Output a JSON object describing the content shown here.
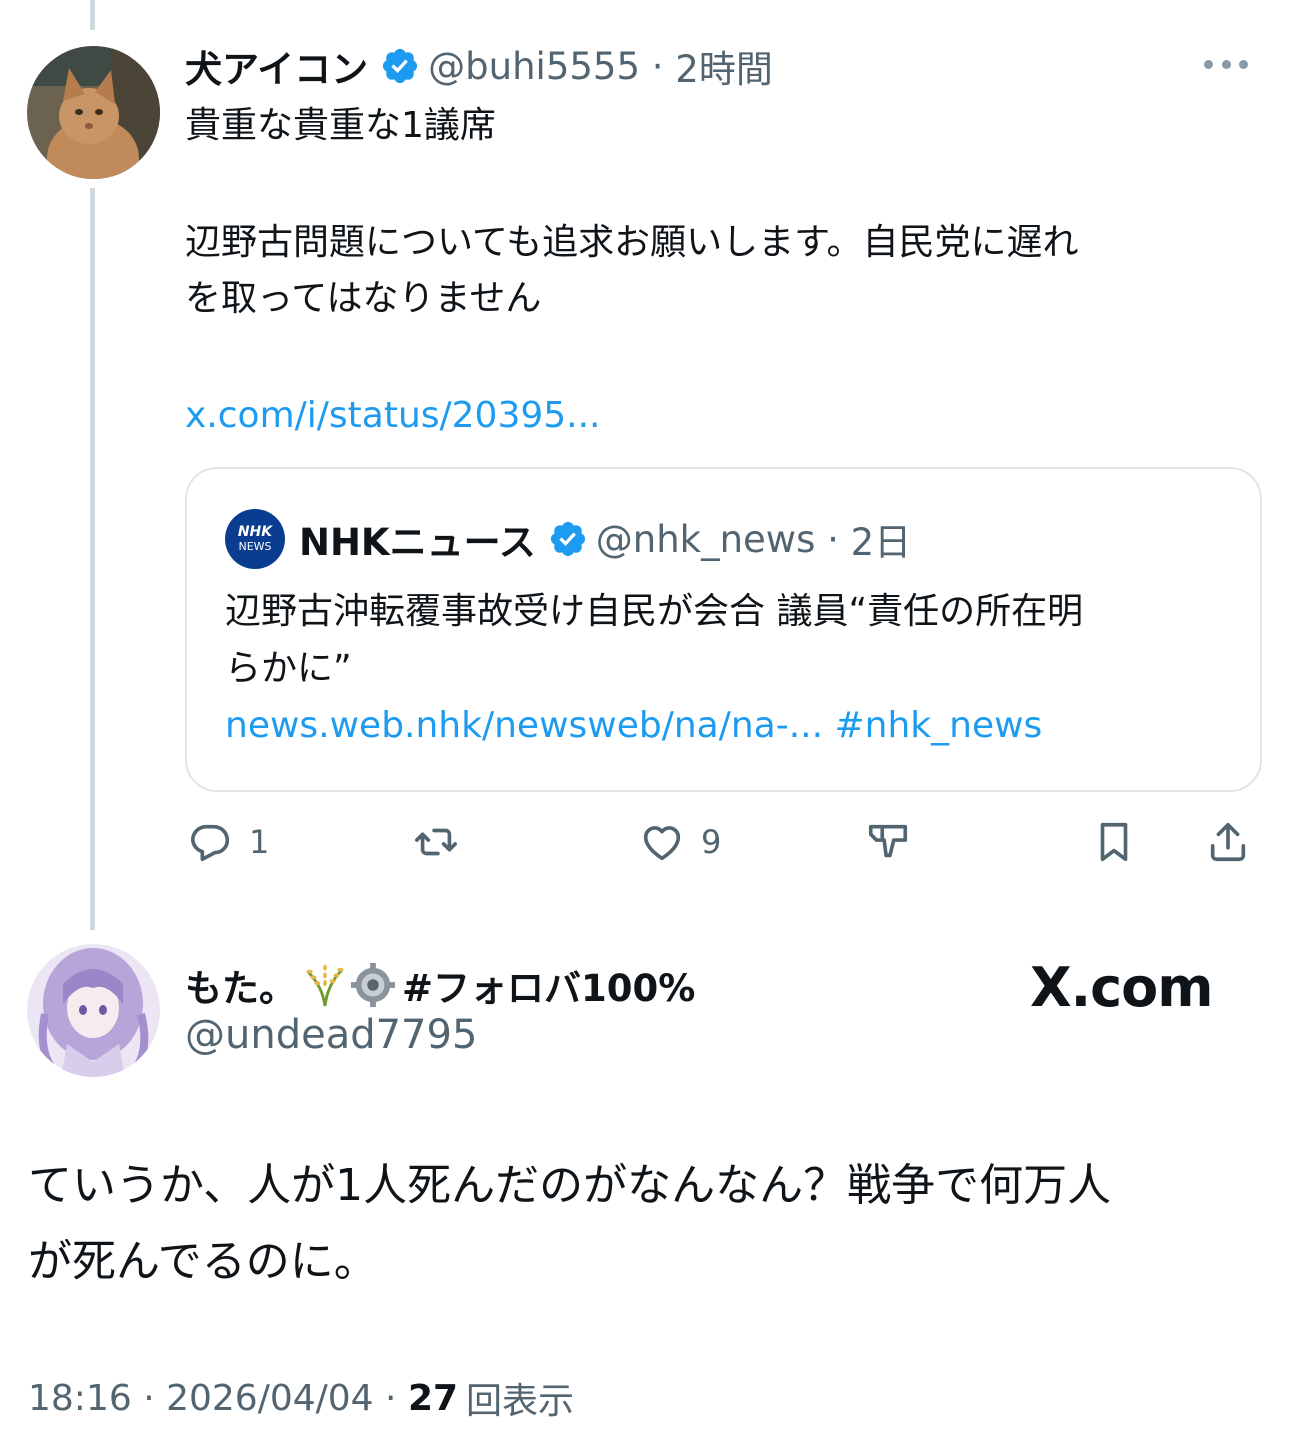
{
  "parent_tweet": {
    "display_name": "犬アイコン",
    "handle": "@buhi5555",
    "time": "2時間",
    "line1": "貴重な貴重な1議席",
    "line2": "辺野古問題についても追求お願いします。自民党に遅れ",
    "line3": "を取ってはなりません",
    "link": "x.com/i/status/20395...",
    "quote": {
      "logo_top": "NHK",
      "logo_bottom": "NEWS",
      "display_name": "NHKニュース",
      "handle": "@nhk_news",
      "time": "2日",
      "line1": "辺野古沖転覆事故受け自民が会合 議員“責任の所在明",
      "line2": "らかに”",
      "link": "news.web.nhk/newsweb/na/na-...",
      "hashtag": "#nhk_news"
    },
    "actions": {
      "reply_count": "1",
      "like_count": "9"
    }
  },
  "reply": {
    "display_name_prefix": "もた。",
    "display_name_suffix": "#フォロバ100%",
    "handle": "@undead7795",
    "watermark": "X.com",
    "line1": "ていうか、人が1人死んだのがなんなん？戦争で何万人",
    "line2": "が死んでるのに。",
    "time": "18:16",
    "date": "2026/04/04",
    "views_count": "27",
    "views_label": "回表示"
  },
  "colors": {
    "link": "#1d9bf0",
    "verified": "#1d9bf0",
    "secondary_text": "#536471",
    "thread_line": "#cfd9de"
  },
  "icons": [
    "verified-badge-icon",
    "more-icon",
    "reply-icon",
    "retweet-icon",
    "like-icon",
    "dislike-icon",
    "bookmark-icon",
    "share-icon",
    "rice-emoji-icon",
    "gear-emoji-icon"
  ]
}
